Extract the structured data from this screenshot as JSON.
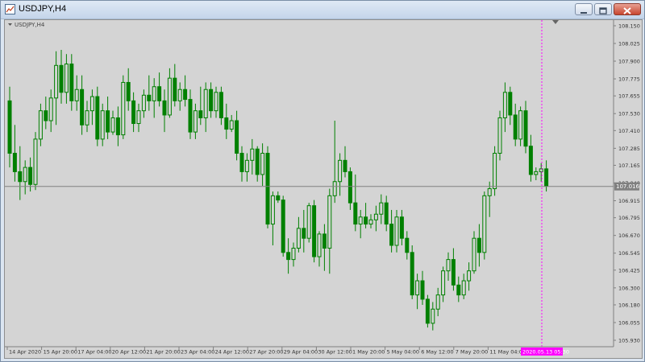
{
  "window": {
    "title": "USDJPY,H4",
    "buttons": [
      "minimize",
      "restore",
      "close"
    ]
  },
  "chart_label": "USDJPY,H4",
  "colors": {
    "background": "#d4d4d4",
    "candle": "#008000",
    "axis": "#808080",
    "price_line": "#808080",
    "price_tag_bg": "#808080",
    "price_tag_text": "#ffffff",
    "time_tag_bg": "#ff00ff",
    "crosshair": "#ff00ff"
  },
  "price_axis": {
    "labels": [
      "108.150",
      "108.025",
      "107.900",
      "107.775",
      "107.655",
      "107.530",
      "107.410",
      "107.285",
      "107.165",
      "107.040",
      "106.915",
      "106.795",
      "106.670",
      "106.545",
      "106.425",
      "106.300",
      "106.180",
      "106.055",
      "105.930"
    ],
    "current_price": "107.016",
    "min": 105.93,
    "max": 108.15
  },
  "time_axis": {
    "labels": [
      "14 Apr 2020",
      "15 Apr 20:00",
      "17 Apr 04:00",
      "20 Apr 12:00",
      "21 Apr 20:00",
      "23 Apr 04:00",
      "24 Apr 12:00",
      "27 Apr 20:00",
      "29 Apr 04:00",
      "30 Apr 12:00",
      "1 May 20:00",
      "5 May 04:00",
      "6 May 12:00",
      "7 May 20:00",
      "11 May 04:00"
    ],
    "cursor_time": "2020.05.13 05:30"
  },
  "chart_data": {
    "type": "candlestick",
    "symbol": "USDJPY",
    "timeframe": "H4",
    "ylim": [
      105.93,
      108.15
    ],
    "current_price": 107.016,
    "candles": [
      [
        107.62,
        107.72,
        107.15,
        107.25
      ],
      [
        107.25,
        107.45,
        107.05,
        107.12
      ],
      [
        107.12,
        107.3,
        106.92,
        107.05
      ],
      [
        107.05,
        107.2,
        106.96,
        107.15
      ],
      [
        107.15,
        107.22,
        106.98,
        107.03
      ],
      [
        107.03,
        107.4,
        106.99,
        107.35
      ],
      [
        107.35,
        107.6,
        107.3,
        107.55
      ],
      [
        107.55,
        107.65,
        107.42,
        107.48
      ],
      [
        107.48,
        107.7,
        107.4,
        107.64
      ],
      [
        107.64,
        107.97,
        107.45,
        107.87
      ],
      [
        107.87,
        107.98,
        107.6,
        107.68
      ],
      [
        107.68,
        107.95,
        107.6,
        107.88
      ],
      [
        107.88,
        107.95,
        107.55,
        107.62
      ],
      [
        107.62,
        107.8,
        107.55,
        107.7
      ],
      [
        107.7,
        107.8,
        107.38,
        107.45
      ],
      [
        107.45,
        107.62,
        107.4,
        107.55
      ],
      [
        107.55,
        107.7,
        107.45,
        107.65
      ],
      [
        107.65,
        107.72,
        107.3,
        107.35
      ],
      [
        107.35,
        107.6,
        107.3,
        107.55
      ],
      [
        107.55,
        107.65,
        107.35,
        107.4
      ],
      [
        107.4,
        107.55,
        107.38,
        107.5
      ],
      [
        107.5,
        107.58,
        107.3,
        107.38
      ],
      [
        107.38,
        107.8,
        107.35,
        107.75
      ],
      [
        107.75,
        107.85,
        107.55,
        107.62
      ],
      [
        107.62,
        107.68,
        107.4,
        107.46
      ],
      [
        107.46,
        107.6,
        107.4,
        107.55
      ],
      [
        107.55,
        107.7,
        107.5,
        107.66
      ],
      [
        107.66,
        107.8,
        107.55,
        107.62
      ],
      [
        107.62,
        107.78,
        107.5,
        107.72
      ],
      [
        107.72,
        107.82,
        107.58,
        107.62
      ],
      [
        107.62,
        107.7,
        107.4,
        107.52
      ],
      [
        107.52,
        107.85,
        107.5,
        107.78
      ],
      [
        107.78,
        107.88,
        107.58,
        107.62
      ],
      [
        107.62,
        107.75,
        107.55,
        107.7
      ],
      [
        107.7,
        107.8,
        107.58,
        107.63
      ],
      [
        107.63,
        107.7,
        107.35,
        107.4
      ],
      [
        107.4,
        107.6,
        107.35,
        107.55
      ],
      [
        107.55,
        107.72,
        107.45,
        107.5
      ],
      [
        107.5,
        107.75,
        107.4,
        107.7
      ],
      [
        107.7,
        107.75,
        107.5,
        107.55
      ],
      [
        107.55,
        107.72,
        107.5,
        107.68
      ],
      [
        107.68,
        107.72,
        107.45,
        107.5
      ],
      [
        107.5,
        107.6,
        107.35,
        107.42
      ],
      [
        107.42,
        107.52,
        107.4,
        107.48
      ],
      [
        107.48,
        107.55,
        107.2,
        107.25
      ],
      [
        107.25,
        107.3,
        107.05,
        107.12
      ],
      [
        107.12,
        107.25,
        107.05,
        107.2
      ],
      [
        107.2,
        107.35,
        107.1,
        107.28
      ],
      [
        107.28,
        107.3,
        107.05,
        107.1
      ],
      [
        107.1,
        107.32,
        107.02,
        107.25
      ],
      [
        107.25,
        107.3,
        106.72,
        106.75
      ],
      [
        106.75,
        106.98,
        106.6,
        106.95
      ],
      [
        106.95,
        106.98,
        106.9,
        106.92
      ],
      [
        106.92,
        106.95,
        106.52,
        106.55
      ],
      [
        106.55,
        106.65,
        106.4,
        106.5
      ],
      [
        106.5,
        106.62,
        106.45,
        106.58
      ],
      [
        106.58,
        106.8,
        106.55,
        106.72
      ],
      [
        106.72,
        106.85,
        106.55,
        106.65
      ],
      [
        106.65,
        106.9,
        106.62,
        106.88
      ],
      [
        106.88,
        106.92,
        106.48,
        106.52
      ],
      [
        106.52,
        106.7,
        106.45,
        106.68
      ],
      [
        106.68,
        106.75,
        106.42,
        106.58
      ],
      [
        106.58,
        107.0,
        106.4,
        106.95
      ],
      [
        106.95,
        107.48,
        106.9,
        107.05
      ],
      [
        107.05,
        107.25,
        106.95,
        107.2
      ],
      [
        107.2,
        107.3,
        107.08,
        107.12
      ],
      [
        107.12,
        107.15,
        106.85,
        106.9
      ],
      [
        106.9,
        107.1,
        106.7,
        106.75
      ],
      [
        106.75,
        106.85,
        106.65,
        106.8
      ],
      [
        106.8,
        106.9,
        106.72,
        106.75
      ],
      [
        106.75,
        106.82,
        106.72,
        106.78
      ],
      [
        106.78,
        106.88,
        106.7,
        106.82
      ],
      [
        106.82,
        106.96,
        106.75,
        106.9
      ],
      [
        106.9,
        106.95,
        106.7,
        106.75
      ],
      [
        106.75,
        106.85,
        106.55,
        106.6
      ],
      [
        106.6,
        106.85,
        106.55,
        106.8
      ],
      [
        106.8,
        106.85,
        106.6,
        106.65
      ],
      [
        106.65,
        106.7,
        106.5,
        106.55
      ],
      [
        106.55,
        106.6,
        106.22,
        106.25
      ],
      [
        106.25,
        106.4,
        106.15,
        106.35
      ],
      [
        106.35,
        106.42,
        106.18,
        106.22
      ],
      [
        106.22,
        106.25,
        106.02,
        106.05
      ],
      [
        106.05,
        106.2,
        106.0,
        106.15
      ],
      [
        106.15,
        106.3,
        106.1,
        106.25
      ],
      [
        106.25,
        106.45,
        106.2,
        106.42
      ],
      [
        106.42,
        106.55,
        106.35,
        106.5
      ],
      [
        106.5,
        106.58,
        106.28,
        106.32
      ],
      [
        106.32,
        106.38,
        106.2,
        106.25
      ],
      [
        106.25,
        106.4,
        106.22,
        106.35
      ],
      [
        106.35,
        106.48,
        106.28,
        106.42
      ],
      [
        106.42,
        106.7,
        106.4,
        106.65
      ],
      [
        106.65,
        106.75,
        106.45,
        106.55
      ],
      [
        106.55,
        106.98,
        106.5,
        106.95
      ],
      [
        106.95,
        107.05,
        106.8,
        107.0
      ],
      [
        107.0,
        107.3,
        106.95,
        107.25
      ],
      [
        107.25,
        107.55,
        107.2,
        107.5
      ],
      [
        107.5,
        107.75,
        107.4,
        107.68
      ],
      [
        107.68,
        107.72,
        107.45,
        107.52
      ],
      [
        107.52,
        107.6,
        107.3,
        107.35
      ],
      [
        107.35,
        107.58,
        107.3,
        107.55
      ],
      [
        107.55,
        107.62,
        107.25,
        107.3
      ],
      [
        107.3,
        107.38,
        107.05,
        107.1
      ],
      [
        107.1,
        107.15,
        107.06,
        107.12
      ],
      [
        107.12,
        107.18,
        107.05,
        107.14
      ],
      [
        107.14,
        107.2,
        106.98,
        107.02
      ]
    ]
  }
}
